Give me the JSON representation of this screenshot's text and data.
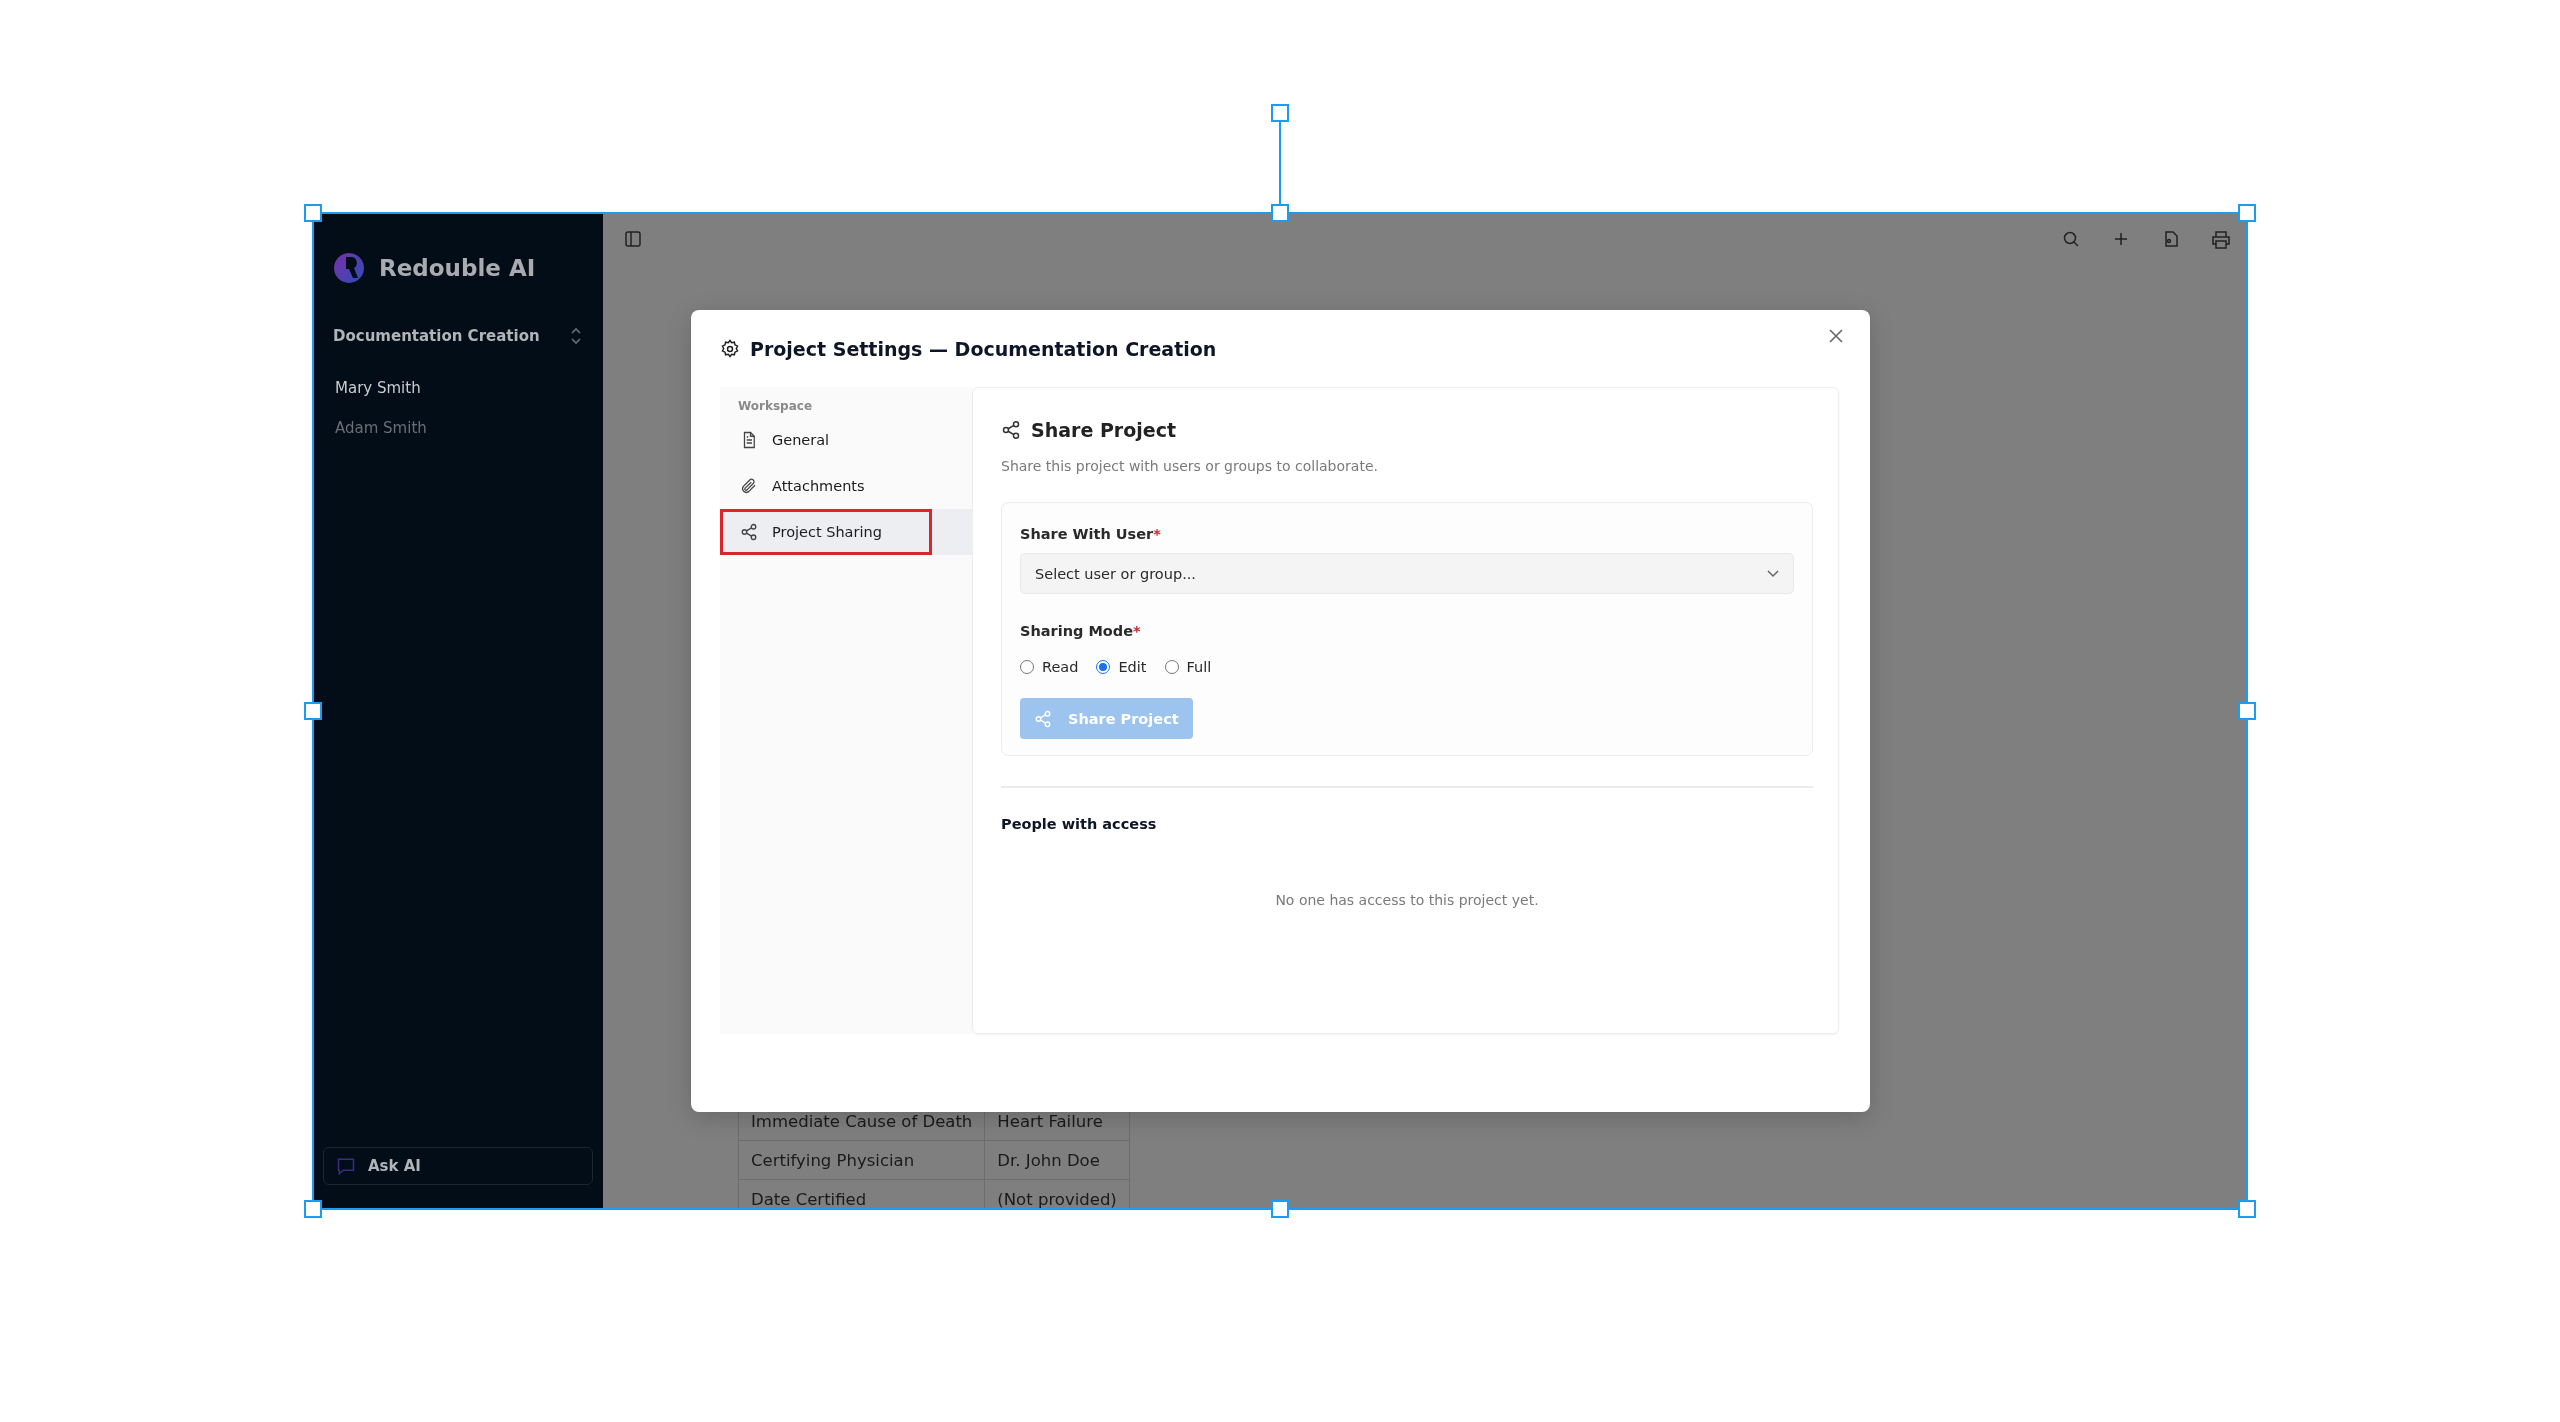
{
  "canvas": {
    "frame_selected": true
  },
  "sidebar": {
    "brand": "Redouble AI",
    "project": "Documentation Creation",
    "items": [
      {
        "label": "Mary Smith",
        "selected": true
      },
      {
        "label": "Adam Smith",
        "selected": false
      }
    ],
    "ask_ai": "Ask AI"
  },
  "page": {
    "table": {
      "rows": [
        [
          "Immediate Cause of Death",
          "Heart Failure"
        ],
        [
          "Certifying Physician",
          "Dr. John Doe"
        ],
        [
          "Date Certified",
          "(Not provided)"
        ]
      ]
    }
  },
  "dialog": {
    "title": "Project Settings — Documentation Creation",
    "nav": {
      "section": "Workspace",
      "items": [
        {
          "label": "General",
          "selected": false,
          "highlighted": false
        },
        {
          "label": "Attachments",
          "selected": false,
          "highlighted": false
        },
        {
          "label": "Project Sharing",
          "selected": true,
          "highlighted": true
        }
      ]
    },
    "panel": {
      "title": "Share Project",
      "description": "Share this project with users or groups to collaborate.",
      "user_field": {
        "label": "Share With User",
        "required_mark": "*",
        "placeholder": "Select user or group..."
      },
      "mode": {
        "label": "Sharing Mode",
        "required_mark": "*",
        "options": [
          {
            "label": "Read",
            "selected": false
          },
          {
            "label": "Edit",
            "selected": true
          },
          {
            "label": "Full",
            "selected": false
          }
        ]
      },
      "submit": {
        "label": "Share Project",
        "disabled": true
      },
      "access": {
        "title": "People with access",
        "empty": "No one has access to this project yet."
      }
    }
  }
}
